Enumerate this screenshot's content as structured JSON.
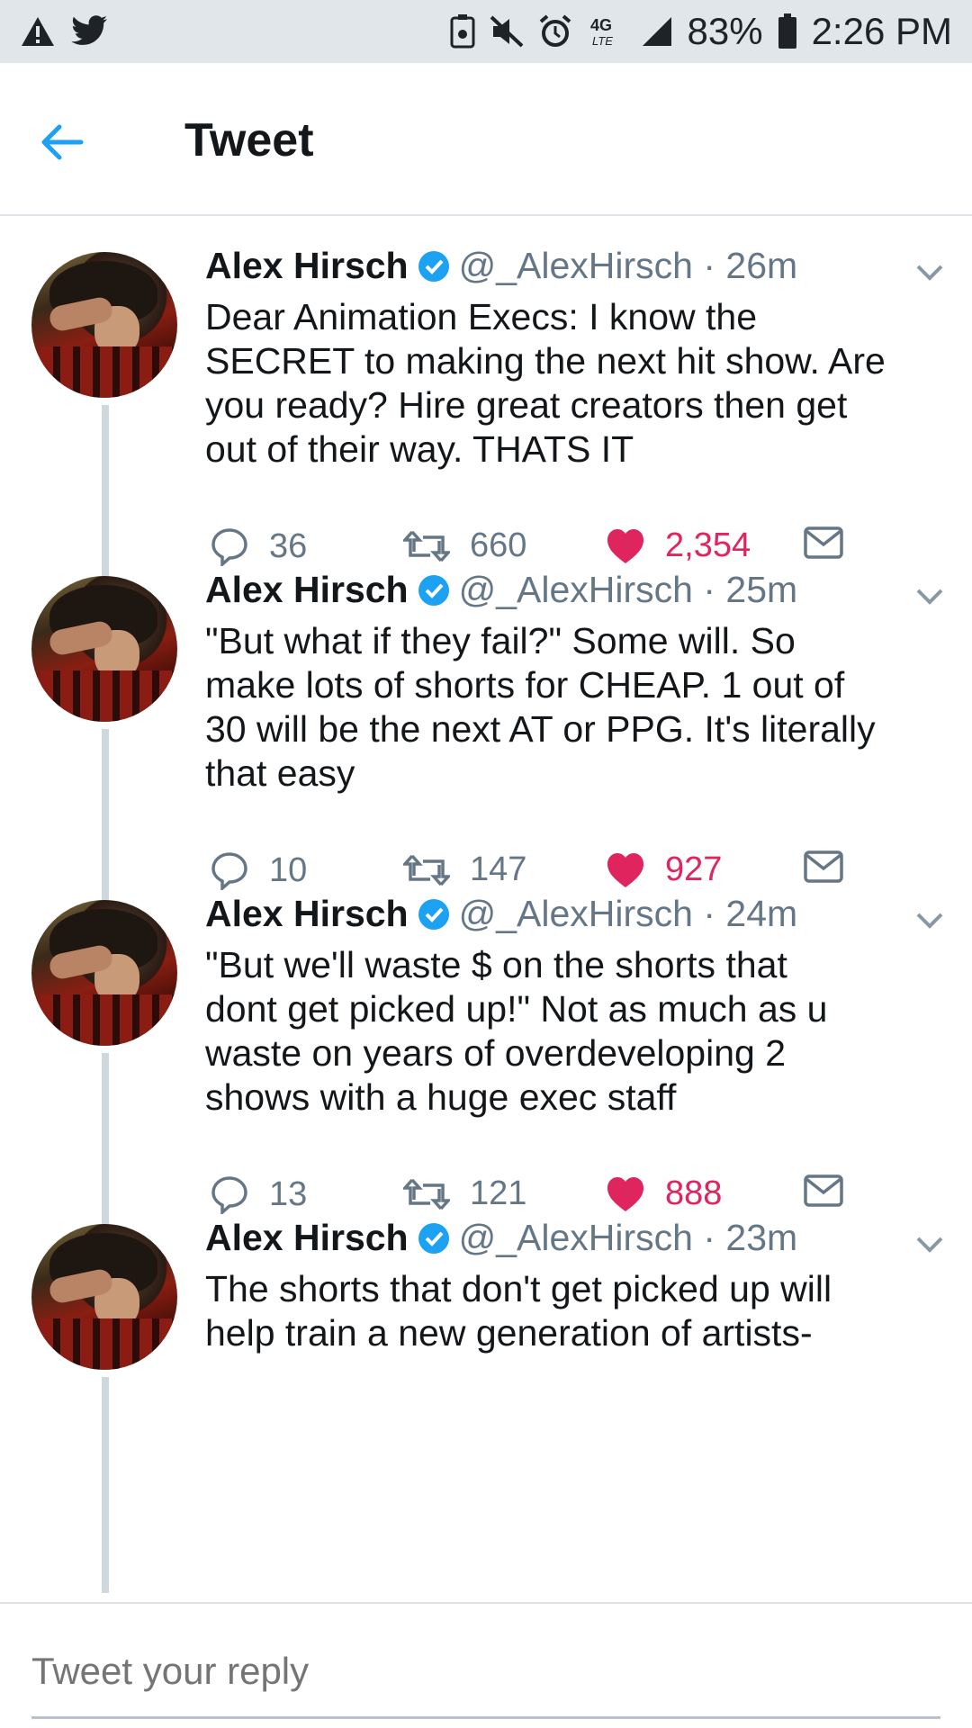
{
  "status_bar": {
    "battery": "83%",
    "time": "2:26 PM",
    "network": "4G LTE",
    "left_icons": [
      "alert-icon",
      "twitter-bird-icon"
    ],
    "right_icons": [
      "alarm-lock-icon",
      "mute-icon",
      "alarm-icon",
      "lte-icon",
      "signal-icon",
      "battery-icon"
    ]
  },
  "header": {
    "title": "Tweet",
    "back_icon": "back-arrow-icon"
  },
  "colors": {
    "accent": "#1da1f2",
    "like": "#e0245e",
    "secondary_text": "#657786",
    "status_bar_bg": "#e1e6ea"
  },
  "tweets": [
    {
      "author": "Alex Hirsch",
      "handle": "@_AlexHirsch · 26m",
      "text": "Dear Animation Execs: I know the\nSECRET to making the next hit show. Are\nyou ready? Hire great creators then get\nout of their way. THATS IT",
      "replies": "36",
      "retweets": "660",
      "likes": "2,354"
    },
    {
      "author": "Alex Hirsch",
      "handle": "@_AlexHirsch · 25m",
      "text": "\"But what if they fail?\" Some will. So\nmake lots of shorts for CHEAP. 1 out of\n30 will be the next AT or PPG. It's literally\nthat easy",
      "replies": "10",
      "retweets": "147",
      "likes": "927"
    },
    {
      "author": "Alex Hirsch",
      "handle": "@_AlexHirsch · 24m",
      "text": "\"But we'll waste $ on the shorts that\ndont get picked up!\" Not as much as u\nwaste on years of overdeveloping 2\nshows with a huge exec staff",
      "replies": "13",
      "retweets": "121",
      "likes": "888"
    },
    {
      "author": "Alex Hirsch",
      "handle": "@_AlexHirsch · 23m",
      "text": "The shorts that don't get picked up will\nhelp train a new generation of artists-",
      "replies": "",
      "retweets": "",
      "likes": ""
    }
  ],
  "reply": {
    "placeholder": "Tweet your reply"
  }
}
